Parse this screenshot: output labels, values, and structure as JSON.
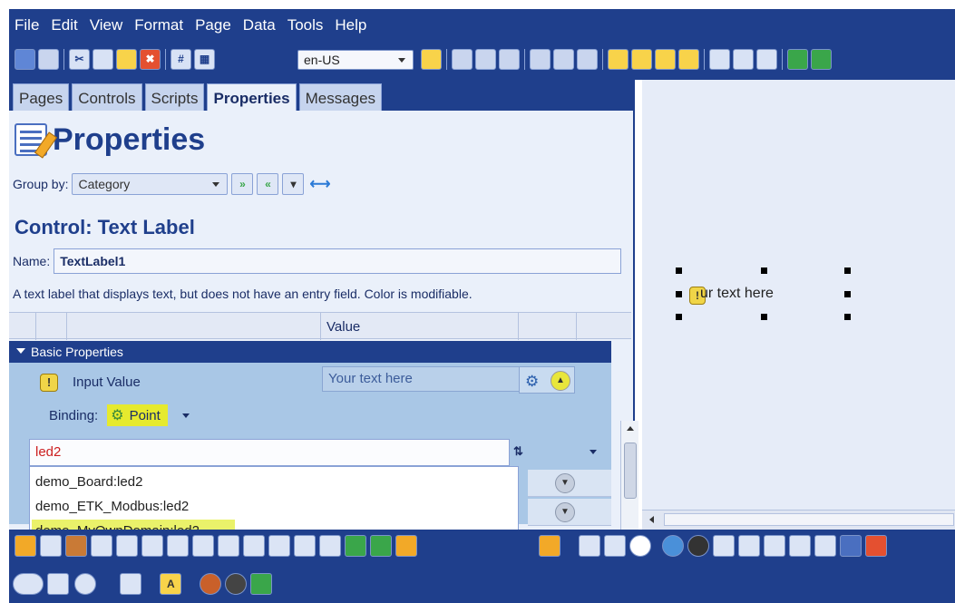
{
  "menu": [
    "File",
    "Edit",
    "View",
    "Format",
    "Page",
    "Data",
    "Tools",
    "Help"
  ],
  "toolbar": {
    "language": "en-US"
  },
  "tabs": [
    {
      "label": "Pages",
      "active": false
    },
    {
      "label": "Controls",
      "active": false
    },
    {
      "label": "Scripts",
      "active": false
    },
    {
      "label": "Properties",
      "active": true
    },
    {
      "label": "Messages",
      "active": false
    }
  ],
  "properties": {
    "title": "Properties",
    "group_by_label": "Group by:",
    "group_by_value": "Category",
    "control_title": "Control: Text Label",
    "name_label": "Name:",
    "name_value": "TextLabel1",
    "description": "A text label that displays text, but does not have an entry field. Color is modifiable."
  },
  "grid": {
    "value_header": "Value",
    "section": "Basic Properties",
    "property_name": "Input Value",
    "property_value": "Your text here",
    "binding_label": "Binding:",
    "binding_value": "Point",
    "search_value": "led2",
    "dropdown_items": [
      "demo_Board:led2",
      "demo_ETK_Modbus:led2",
      "demo_MyOwnDomain:led2"
    ],
    "highlighted_item": "demo_MyOwnDomain:led2"
  },
  "canvas": {
    "label_text": "ur text here"
  },
  "colors": {
    "chrome": "#1f3f8c",
    "highlight": "#e6ea2e",
    "panel": "#eaf0fa"
  }
}
